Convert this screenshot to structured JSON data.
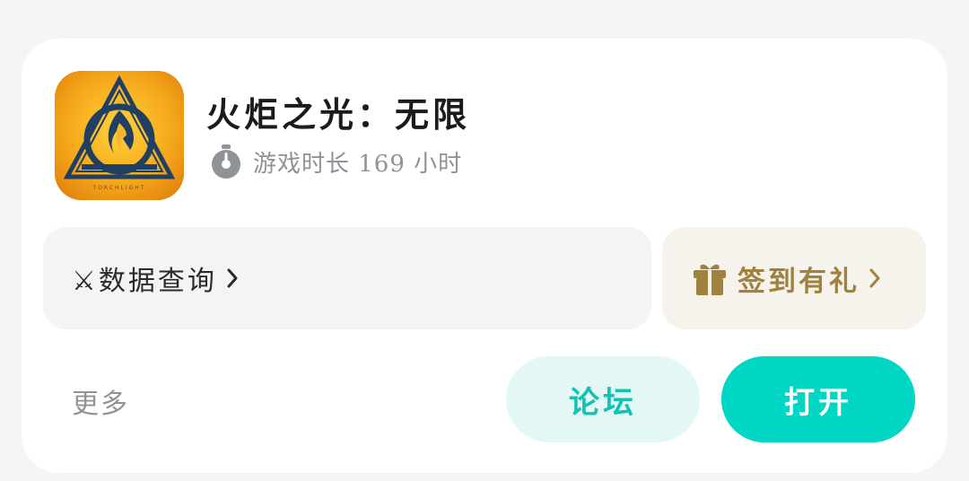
{
  "app": {
    "title": "火炬之光：无限",
    "icon": "torchlight-infinite-logo",
    "playtime_text": "游戏时长 169 小时",
    "playtime_icon": "stopwatch-icon"
  },
  "actions": {
    "data_query_label": "⚔数据查询",
    "signin_label": "签到有礼",
    "signin_icon": "gift-icon",
    "more_label": "更多",
    "forum_label": "论坛",
    "open_label": "打开"
  },
  "colors": {
    "accent": "#00d6c4",
    "forum_bg": "#e3f8f6",
    "forum_text": "#14c2b4",
    "signin_text": "#a0813e",
    "signin_bg": "#f5f3ec",
    "card_bg": "#ffffff",
    "page_bg": "#f4f5f7"
  }
}
